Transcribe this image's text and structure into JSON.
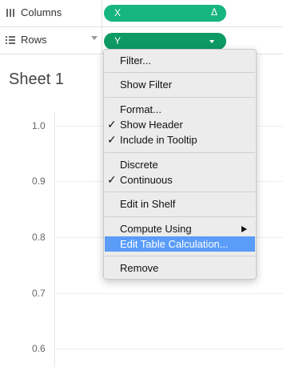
{
  "shelves": {
    "columns": {
      "label": "Columns",
      "pill": "X",
      "pill_icon": "delta-icon",
      "pill_badge": "Δ"
    },
    "rows": {
      "label": "Rows",
      "pill": "Y"
    }
  },
  "sheet": {
    "title": "Sheet 1",
    "y_ticks": [
      "1.0",
      "0.9",
      "0.8",
      "0.7",
      "0.6"
    ]
  },
  "context_menu": {
    "items": [
      {
        "label": "Filter..."
      },
      {
        "label": "Show Filter"
      },
      {
        "label": "Format..."
      },
      {
        "label": "Show Header",
        "checked": true
      },
      {
        "label": "Include in Tooltip",
        "checked": true
      },
      {
        "label": "Discrete"
      },
      {
        "label": "Continuous",
        "checked": true
      },
      {
        "label": "Edit in Shelf"
      },
      {
        "label": "Compute Using",
        "submenu": true
      },
      {
        "label": "Edit Table Calculation...",
        "highlighted": true
      },
      {
        "label": "Remove"
      }
    ],
    "check_glyph": "✓"
  },
  "colors": {
    "pill_light": "#17b57f",
    "pill_dark": "#0e9a63",
    "menu_highlight": "#5a9cf8"
  }
}
